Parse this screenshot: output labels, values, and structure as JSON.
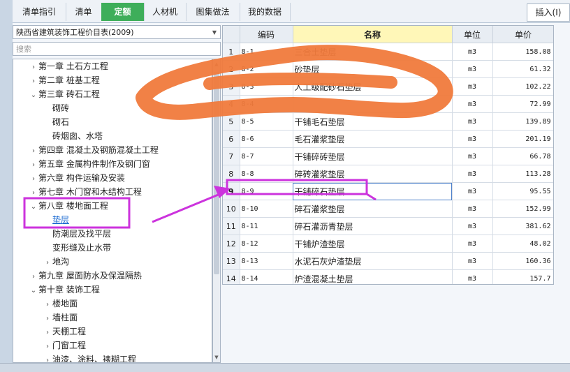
{
  "tabs": [
    {
      "label": "清单指引",
      "active": false
    },
    {
      "label": "清单",
      "active": false
    },
    {
      "label": "定额",
      "active": true
    },
    {
      "label": "人材机",
      "active": false
    },
    {
      "label": "图集做法",
      "active": false
    },
    {
      "label": "我的数据",
      "active": false
    }
  ],
  "insert_label": "插入(I)",
  "catalog": {
    "selected": "陕西省建筑装饰工程价目表(2009)"
  },
  "search": {
    "placeholder": "搜索"
  },
  "tree": [
    {
      "label": "第一章  土石方工程",
      "level": 0,
      "chevron": "›"
    },
    {
      "label": "第二章  桩基工程",
      "level": 0,
      "chevron": "›"
    },
    {
      "label": "第三章  砖石工程",
      "level": 0,
      "chevron": "⌄"
    },
    {
      "label": "砌砖",
      "level": 1,
      "chevron": ""
    },
    {
      "label": "砌石",
      "level": 1,
      "chevron": ""
    },
    {
      "label": "砖烟囱、水塔",
      "level": 1,
      "chevron": ""
    },
    {
      "label": "第四章  混凝土及钢筋混凝土工程",
      "level": 0,
      "chevron": "›"
    },
    {
      "label": "第五章  金属构件制作及钢门窗",
      "level": 0,
      "chevron": "›"
    },
    {
      "label": "第六章  构件运输及安装",
      "level": 0,
      "chevron": "›"
    },
    {
      "label": "第七章  木门窗和木结构工程",
      "level": 0,
      "chevron": "›"
    },
    {
      "label": "第八章  楼地面工程",
      "level": 0,
      "chevron": "⌄"
    },
    {
      "label": "垫层",
      "level": 1,
      "chevron": "",
      "selected": true
    },
    {
      "label": "防潮层及找平层",
      "level": 1,
      "chevron": ""
    },
    {
      "label": "变形缝及止水带",
      "level": 1,
      "chevron": ""
    },
    {
      "label": "地沟",
      "level": 1,
      "chevron": "›"
    },
    {
      "label": "第九章  屋面防水及保温隔热",
      "level": 0,
      "chevron": "›"
    },
    {
      "label": "第十章  装饰工程",
      "level": 0,
      "chevron": "⌄"
    },
    {
      "label": "楼地面",
      "level": 1,
      "chevron": "›"
    },
    {
      "label": "墙柱面",
      "level": 1,
      "chevron": "›"
    },
    {
      "label": "天棚工程",
      "level": 1,
      "chevron": "›"
    },
    {
      "label": "门窗工程",
      "level": 1,
      "chevron": "›"
    },
    {
      "label": "油漆、涂料、裱糊工程",
      "level": 1,
      "chevron": "›"
    }
  ],
  "grid": {
    "headers": [
      "",
      "编码",
      "名称",
      "单位",
      "单价"
    ],
    "rows": [
      {
        "n": "1",
        "code": "8-1",
        "name": "三合土垫层",
        "unit": "m3",
        "price": "158.08"
      },
      {
        "n": "2",
        "code": "8-2",
        "name": "砂垫层",
        "unit": "m3",
        "price": "61.32"
      },
      {
        "n": "3",
        "code": "8-3",
        "name": "人工级配砂石垫层",
        "unit": "m3",
        "price": "102.22"
      },
      {
        "n": "4",
        "code": "8-4",
        "name": "",
        "unit": "m3",
        "price": "72.99"
      },
      {
        "n": "5",
        "code": "8-5",
        "name": "干铺毛石垫层",
        "unit": "m3",
        "price": "139.89"
      },
      {
        "n": "6",
        "code": "8-6",
        "name": "毛石灌浆垫层",
        "unit": "m3",
        "price": "201.19"
      },
      {
        "n": "7",
        "code": "8-7",
        "name": "干铺碎砖垫层",
        "unit": "m3",
        "price": "66.78"
      },
      {
        "n": "8",
        "code": "8-8",
        "name": "碎砖灌浆垫层",
        "unit": "m3",
        "price": "113.28"
      },
      {
        "n": "9",
        "code": "8-9",
        "name": "干铺碎石垫层",
        "unit": "m3",
        "price": "95.55",
        "current": true
      },
      {
        "n": "10",
        "code": "8-10",
        "name": "碎石灌浆垫层",
        "unit": "m3",
        "price": "152.99"
      },
      {
        "n": "11",
        "code": "8-11",
        "name": "碎石灌沥青垫层",
        "unit": "m3",
        "price": "381.62"
      },
      {
        "n": "12",
        "code": "8-12",
        "name": "干铺炉渣垫层",
        "unit": "m3",
        "price": "48.02"
      },
      {
        "n": "13",
        "code": "8-13",
        "name": "水泥石灰炉渣垫层",
        "unit": "m3",
        "price": "160.36"
      },
      {
        "n": "14",
        "code": "8-14",
        "name": "炉渣混凝土垫层",
        "unit": "m3",
        "price": "157.7"
      }
    ]
  },
  "colors": {
    "active_tab": "#3eae5a",
    "highlight": "#cc33dd",
    "scribble": "#f07a3c",
    "name_header": "#fff7b8"
  }
}
